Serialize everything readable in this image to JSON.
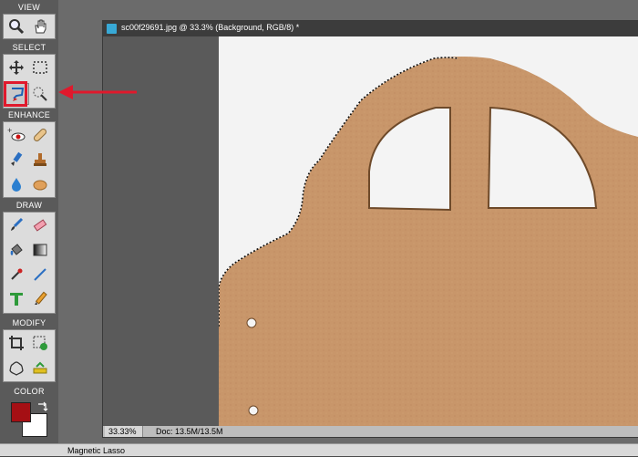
{
  "toolbox": {
    "sections": {
      "view": "VIEW",
      "select": "SELECT",
      "enhance": "ENHANCE",
      "draw": "DRAW",
      "modify": "MODIFY",
      "color": "COLOR"
    },
    "tools": [
      {
        "name": "zoom-tool",
        "icon": "magnifier-icon"
      },
      {
        "name": "hand-tool",
        "icon": "hand-icon"
      },
      {
        "name": "move-tool",
        "icon": "move-arrows-icon"
      },
      {
        "name": "rectangular-marquee-tool",
        "icon": "marquee-icon"
      },
      {
        "name": "magnetic-lasso-tool",
        "icon": "lasso-icon",
        "active": true
      },
      {
        "name": "quick-selection-tool",
        "icon": "quick-select-icon"
      },
      {
        "name": "red-eye-tool",
        "icon": "eye-icon"
      },
      {
        "name": "spot-healing-tool",
        "icon": "bandage-icon"
      },
      {
        "name": "smart-brush-tool",
        "icon": "smart-brush-icon"
      },
      {
        "name": "clone-stamp-tool",
        "icon": "stamp-icon"
      },
      {
        "name": "blur-tool",
        "icon": "drop-icon"
      },
      {
        "name": "sponge-tool",
        "icon": "sponge-icon"
      },
      {
        "name": "brush-tool",
        "icon": "brush-icon"
      },
      {
        "name": "eraser-tool",
        "icon": "eraser-icon"
      },
      {
        "name": "paint-bucket-tool",
        "icon": "bucket-icon"
      },
      {
        "name": "gradient-tool",
        "icon": "gradient-icon"
      },
      {
        "name": "eyedropper-tool",
        "icon": "eyedropper-icon"
      },
      {
        "name": "line-tool",
        "icon": "line-icon"
      },
      {
        "name": "type-tool",
        "icon": "type-icon"
      },
      {
        "name": "pencil-tool",
        "icon": "pencil-icon"
      },
      {
        "name": "crop-tool",
        "icon": "crop-icon"
      },
      {
        "name": "recompose-tool",
        "icon": "recompose-icon"
      },
      {
        "name": "cookie-cutter-tool",
        "icon": "cookie-cutter-icon"
      },
      {
        "name": "straighten-tool",
        "icon": "straighten-icon"
      }
    ],
    "foreground_color": "#a50f14",
    "background_color": "#ffffff"
  },
  "document": {
    "title": "sc00f29691.jpg @ 33.3% (Background, RGB/8) *",
    "zoom": "33.33%",
    "doc_info": "Doc: 13.5M/13.5M"
  },
  "status": {
    "current_tool": "Magnetic Lasso"
  },
  "colors": {
    "highlight": "#e0192c",
    "cardboard": "#c8966a"
  }
}
